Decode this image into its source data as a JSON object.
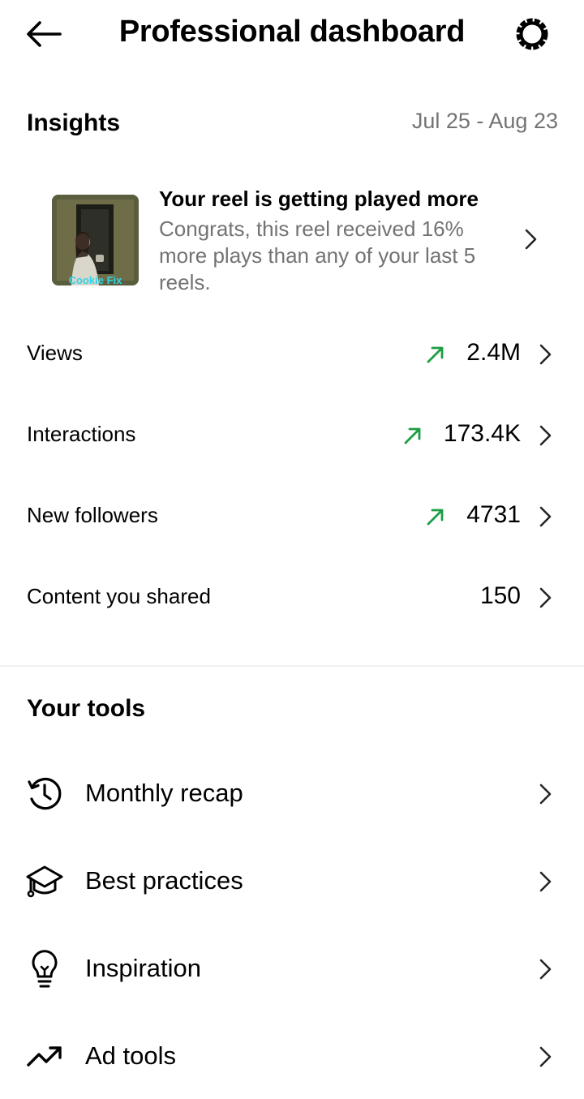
{
  "header": {
    "title": "Professional dashboard",
    "back_icon": "arrow-left-icon",
    "settings_icon": "gear-icon"
  },
  "insights": {
    "title": "Insights",
    "date_range": "Jul 25 - Aug 23",
    "reel_card": {
      "title": "Your reel is getting played more",
      "description": "Congrats, this reel received 16% more plays than any of your last 5 reels.",
      "thumbnail_text": "Cookie Fix"
    },
    "metrics": [
      {
        "label": "Views",
        "value": "2.4M",
        "trend": "up"
      },
      {
        "label": "Interactions",
        "value": "173.4K",
        "trend": "up"
      },
      {
        "label": "New followers",
        "value": "4731",
        "trend": "up"
      },
      {
        "label": "Content you shared",
        "value": "150",
        "trend": "none"
      }
    ]
  },
  "tools": {
    "title": "Your tools",
    "items": [
      {
        "label": "Monthly recap",
        "icon": "history-clock-icon"
      },
      {
        "label": "Best practices",
        "icon": "graduation-cap-icon"
      },
      {
        "label": "Inspiration",
        "icon": "lightbulb-icon"
      },
      {
        "label": "Ad tools",
        "icon": "trending-up-icon"
      }
    ]
  },
  "colors": {
    "trend_up": "#1d9e44",
    "secondary_text": "#737373",
    "text": "#000000"
  }
}
